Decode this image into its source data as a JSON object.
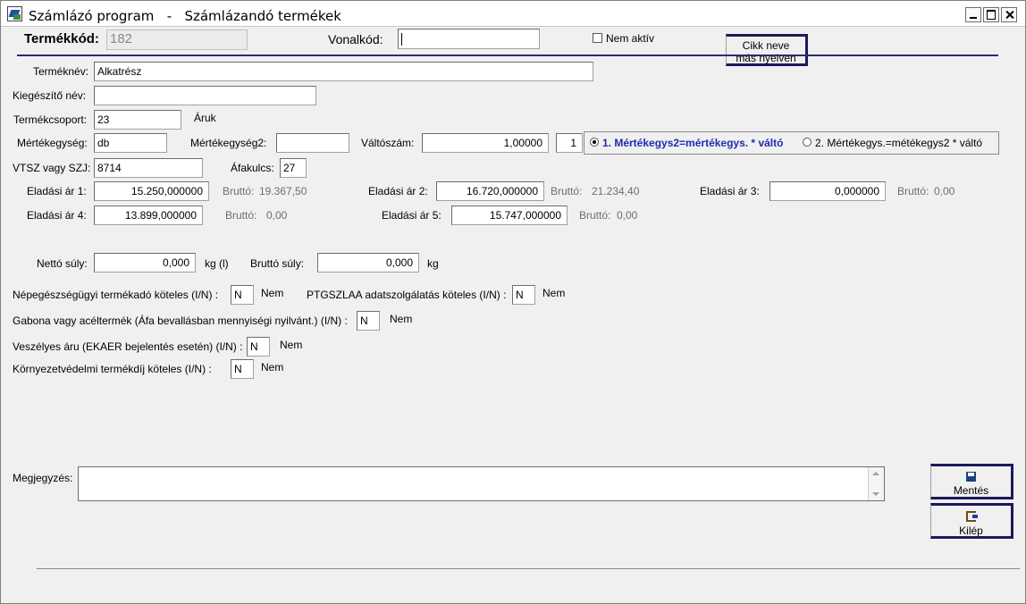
{
  "window": {
    "app_title": "Számlázó program",
    "separator": "-",
    "screen_title": "Számlázandó termékek"
  },
  "header": {
    "termekkod_label": "Termékkód:",
    "termekkod_value": "182",
    "vonalkod_label": "Vonalkód:",
    "vonalkod_value": "",
    "nem_aktiv_label": "Nem aktív",
    "cikk_button": "Cikk neve\nmás nyelven"
  },
  "form": {
    "termeknev_label": "Terméknév:",
    "termeknev_value": "Alkatrész",
    "kiegeszito_label": "Kiegészítő név:",
    "kiegeszito_value": "",
    "termekcsoport_label": "Termékcsoport:",
    "termekcsoport_value": "23",
    "termekcsoport_name": "Áruk",
    "mertekegyseg_label": "Mértékegység:",
    "mertekegyseg_value": "db",
    "mertekegyseg2_label": "Mértékegység2:",
    "mertekegyseg2_value": "",
    "valtoszam_label": "Váltószám:",
    "valtoszam_value": "1,00000",
    "valtoszam2_value": "1",
    "radio1_label": "1.  Mértékegys2=mértékegys. * váltó",
    "radio2_label": "2.  Mértékegys.=métékegys2 * váltó",
    "vtsz_label": "VTSZ vagy SZJ:",
    "vtsz_value": "8714",
    "afakulcs_label": "Áfakulcs:",
    "afakulcs_value": "27",
    "brutto_label": "Bruttó:",
    "ar1_label": "Eladási ár 1:",
    "ar1_value": "15.250,000000",
    "ar1_brutto": "19.367,50",
    "ar2_label": "Eladási ár 2:",
    "ar2_value": "16.720,000000",
    "ar2_brutto": "21.234,40",
    "ar3_label": "Eladási ár 3:",
    "ar3_value": "0,000000",
    "ar3_brutto": "0,00",
    "ar4_label": "Eladási ár 4:",
    "ar4_value": "13.899,000000",
    "ar4_brutto": "0,00",
    "ar5_label": "Eladási ár 5:",
    "ar5_value": "15.747,000000",
    "ar5_brutto": "0,00",
    "netto_suly_label": "Nettó súly:",
    "netto_suly_value": "0,000",
    "netto_unit": "kg (l)",
    "brutto_suly_label": "Bruttó súly:",
    "brutto_suly_value": "0,000",
    "brutto_unit": "kg",
    "nepeg_label": "Népegészségügyi termékadó köteles (I/N) :",
    "nepeg_value": "N",
    "nepeg_text": "Nem",
    "ptg_label": "PTGSZLAA adatszolgálatás köteles (I/N) :",
    "ptg_value": "N",
    "ptg_text": "Nem",
    "gabona_label": "Gabona vagy acéltermék (Áfa bevallásban mennyiségi nyilvánt.) (I/N) :",
    "gabona_value": "N",
    "gabona_text": "Nem",
    "veszelyes_label": "Veszélyes áru (EKAER bejelentés esetén) (I/N) :",
    "veszelyes_value": "N",
    "veszelyes_text": "Nem",
    "kornyezet_label": "Környezetvédelmi termékdíj köteles (I/N) :",
    "kornyezet_value": "N",
    "kornyezet_text": "Nem",
    "megjegyzes_label": "Megjegyzés:",
    "megjegyzes_value": ""
  },
  "buttons": {
    "mentes": "Mentés",
    "kilep": "Kilép"
  }
}
